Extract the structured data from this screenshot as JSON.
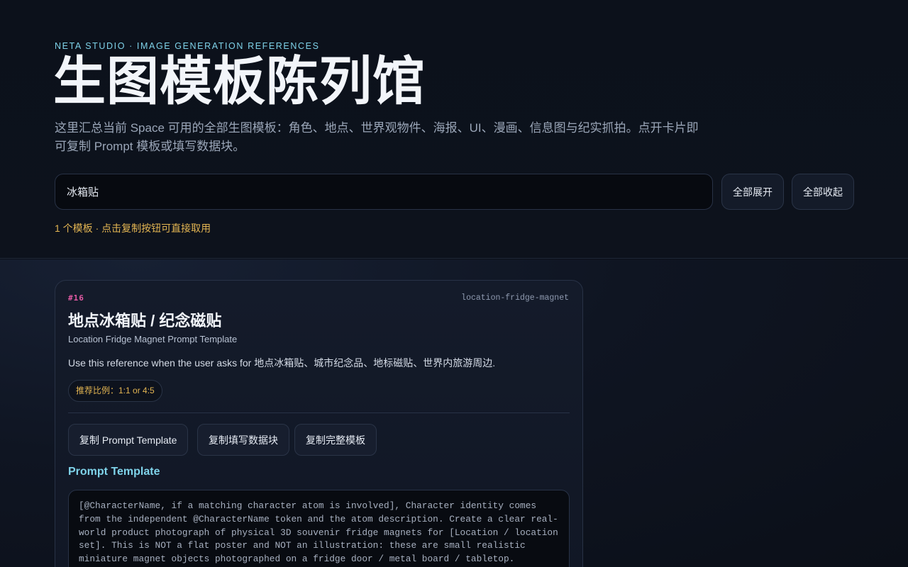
{
  "header": {
    "eyebrow": "NETA STUDIO · IMAGE GENERATION REFERENCES",
    "title": "生图模板陈列馆",
    "subtitle": "这里汇总当前 Space 可用的全部生图模板：角色、地点、世界观物件、海报、UI、漫画、信息图与纪实抓拍。点开卡片即可复制 Prompt 模板或填写数据块。",
    "search_value": "冰箱贴",
    "expand_all_label": "全部展开",
    "collapse_all_label": "全部收起",
    "result_count": "1 个模板 · 点击复制按钮可直接取用"
  },
  "card": {
    "number": "#16",
    "id": "location-fridge-magnet",
    "title": "地点冰箱贴 / 纪念磁贴",
    "subtitle": "Location Fridge Magnet Prompt Template",
    "description": "Use this reference when the user asks for 地点冰箱贴、城市纪念品、地标磁贴、世界内旅游周边.",
    "ratio": "推荐比例：1:1 or 4:5",
    "copy_prompt_label": "复制 Prompt Template",
    "copy_fill_label": "复制填写数据块",
    "copy_full_label": "复制完整模板",
    "prompt_section_label": "Prompt Template",
    "prompt_text": "[@CharacterName, if a matching character atom is involved], Character identity comes from the independent @CharacterName token and the atom description. Create a clear real-world product photograph of physical 3D souvenir fridge magnets for [Location / location set]. This is NOT a flat poster and NOT an illustration: these are small realistic miniature magnet objects photographed on a fridge door / metal board / tabletop."
  },
  "colors": {
    "accent_cyan": "#7fd3ea",
    "accent_gold": "#e3b552",
    "accent_pink": "#e35aa4",
    "background": "#0b0f18"
  }
}
